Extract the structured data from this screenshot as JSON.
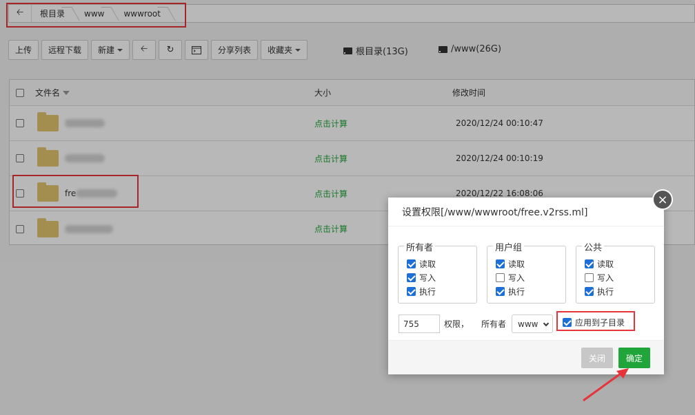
{
  "breadcrumb": {
    "items": [
      "根目录",
      "www",
      "wwwroot"
    ]
  },
  "toolbar": {
    "upload": "上传",
    "remote_download": "远程下载",
    "new": "新建",
    "share_list": "分享列表",
    "favorites": "收藏夹"
  },
  "disks": [
    {
      "label": "根目录(13G)"
    },
    {
      "label": "/www(26G)"
    }
  ],
  "table": {
    "headers": {
      "name": "文件名",
      "size": "大小",
      "modified": "修改时间"
    },
    "rows": [
      {
        "name": "",
        "size": "点击计算",
        "modified": "2020/12/24 00:10:47"
      },
      {
        "name": "",
        "size": "点击计算",
        "modified": "2020/12/24 00:10:19"
      },
      {
        "name": "fre",
        "size": "点击计算",
        "modified": "2020/12/22 16:08:06"
      },
      {
        "name": "",
        "size": "点击计算",
        "modified": ""
      }
    ]
  },
  "modal": {
    "title": "设置权限[/www/wwwroot/free.v2rss.ml]",
    "groups": [
      {
        "legend": "所有者",
        "read": {
          "label": "读取",
          "checked": true
        },
        "write": {
          "label": "写入",
          "checked": true
        },
        "exec": {
          "label": "执行",
          "checked": true
        }
      },
      {
        "legend": "用户组",
        "read": {
          "label": "读取",
          "checked": true
        },
        "write": {
          "label": "写入",
          "checked": false
        },
        "exec": {
          "label": "执行",
          "checked": true
        }
      },
      {
        "legend": "公共",
        "read": {
          "label": "读取",
          "checked": true
        },
        "write": {
          "label": "写入",
          "checked": false
        },
        "exec": {
          "label": "执行",
          "checked": true
        }
      }
    ],
    "mode_value": "755",
    "mode_label": "权限，",
    "owner_label": "所有者",
    "owner_value": "www",
    "apply_sub_label": "应用到子目录",
    "apply_sub_checked": true,
    "close_label": "关闭",
    "confirm_label": "确定"
  },
  "colors": {
    "accent_green": "#20a53a",
    "annotation_red": "#e5343a",
    "checkbox_blue": "#1d6fd8"
  }
}
